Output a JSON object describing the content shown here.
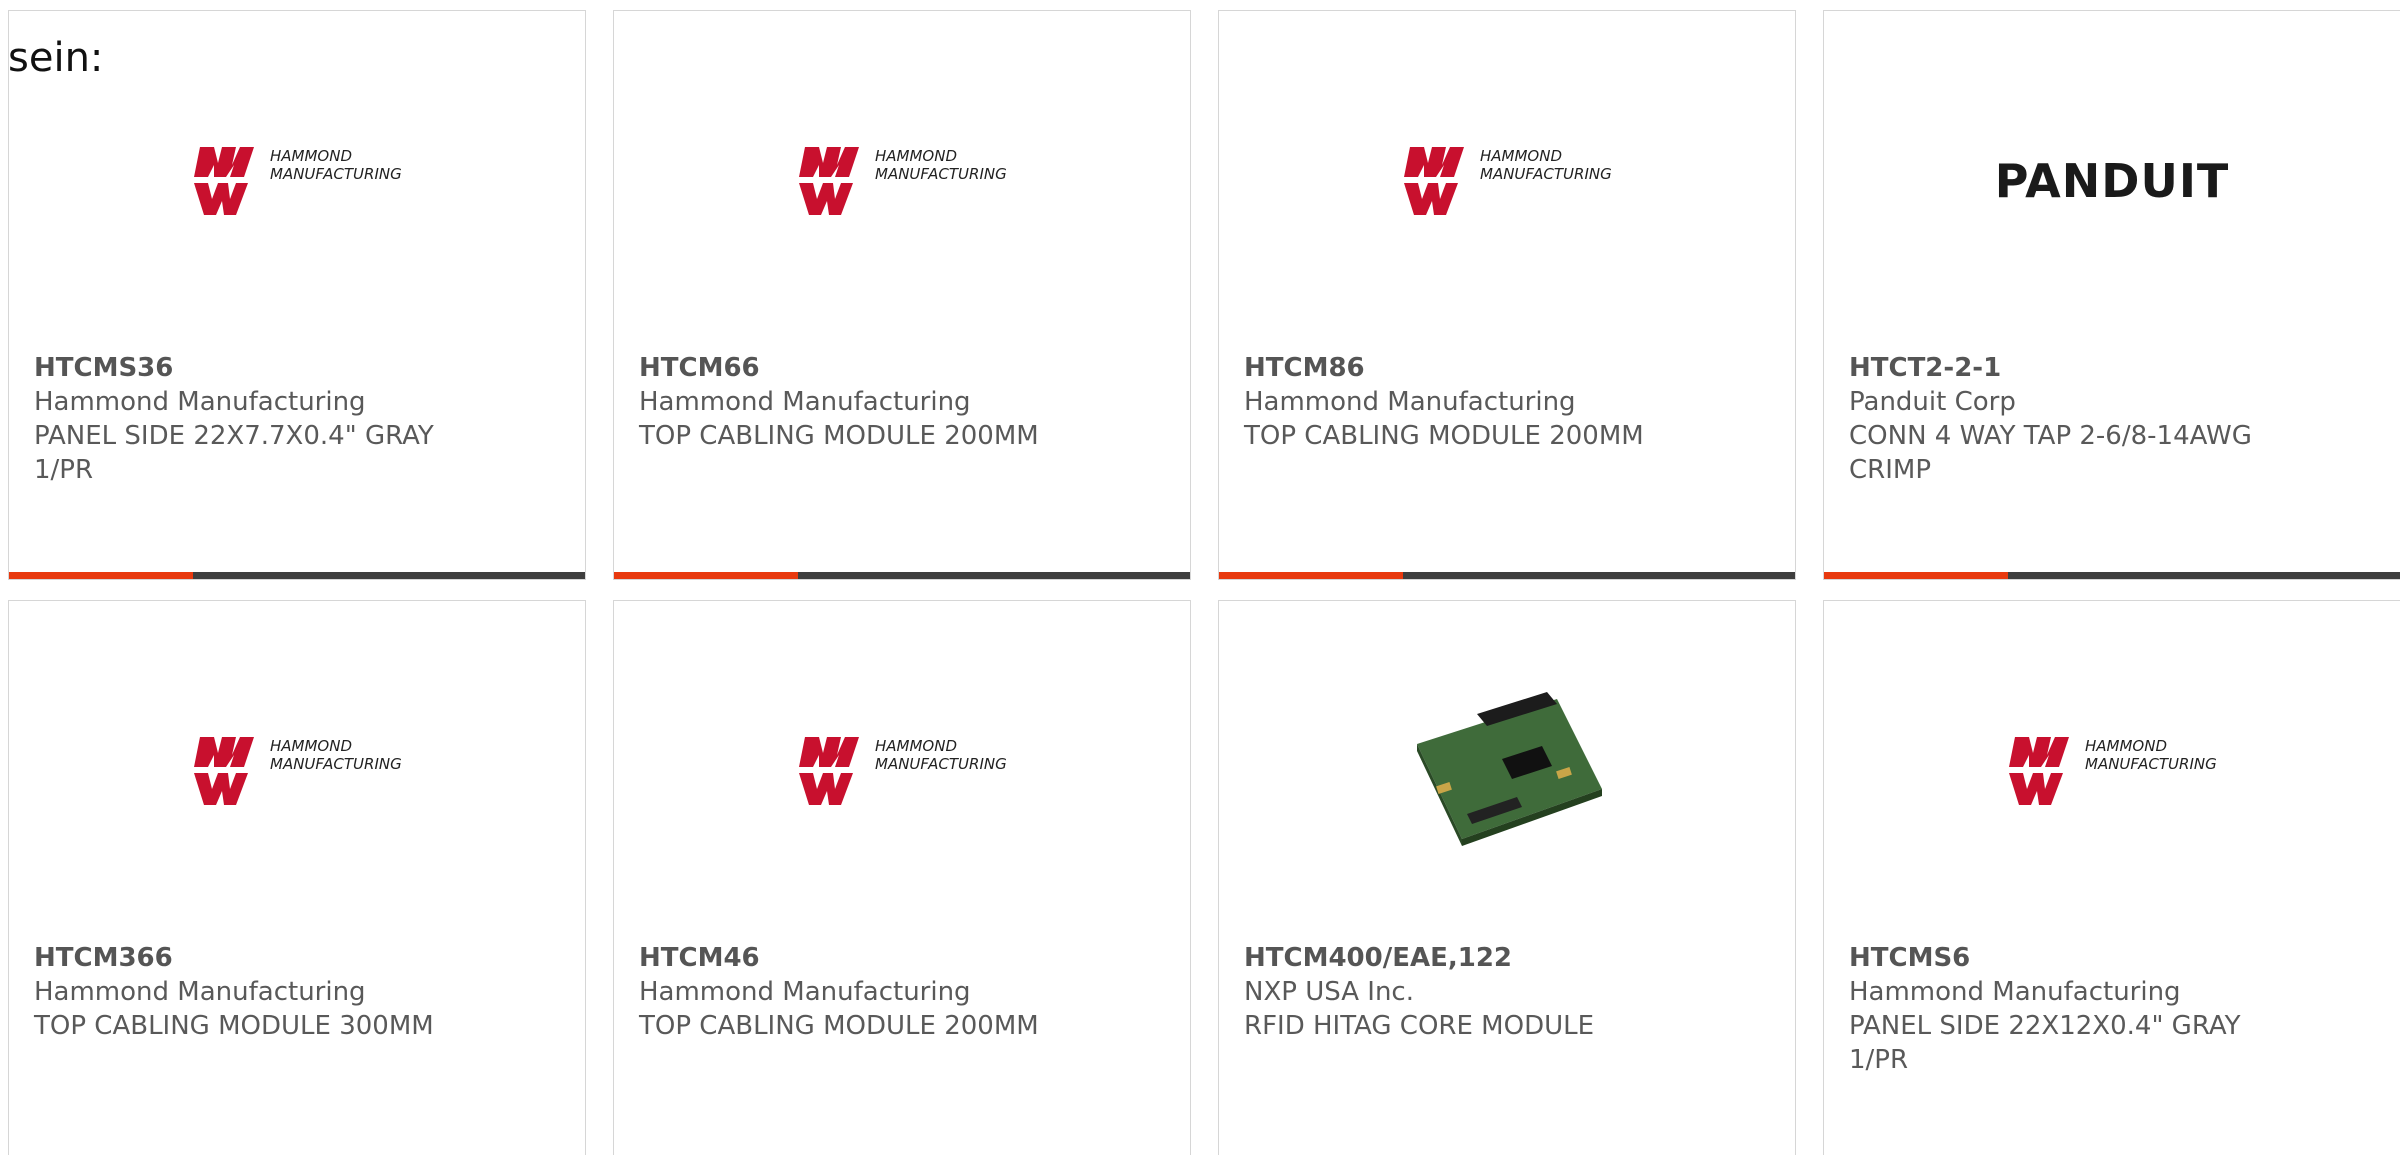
{
  "intro_text": "sein:",
  "products": [
    {
      "part": "HTCMS36",
      "manufacturer": "Hammond Manufacturing",
      "description": "PANEL SIDE 22X7.7X0.4\" GRAY 1/PR",
      "logo": "hammond",
      "hammond_line1": "HAMMOND",
      "hammond_line2": "MANUFACTURING"
    },
    {
      "part": "HTCM66",
      "manufacturer": "Hammond Manufacturing",
      "description": "TOP CABLING MODULE 200MM",
      "logo": "hammond",
      "hammond_line1": "HAMMOND",
      "hammond_line2": "MANUFACTURING"
    },
    {
      "part": "HTCM86",
      "manufacturer": "Hammond Manufacturing",
      "description": "TOP CABLING MODULE 200MM",
      "logo": "hammond",
      "hammond_line1": "HAMMOND",
      "hammond_line2": "MANUFACTURING"
    },
    {
      "part": "HTCT2-2-1",
      "manufacturer": "Panduit Corp",
      "description": "CONN 4 WAY TAP 2-6/8-14AWG CRIMP",
      "logo": "panduit",
      "panduit_text": "PANDUIT"
    },
    {
      "part": "HTCM366",
      "manufacturer": "Hammond Manufacturing",
      "description": "TOP CABLING MODULE 300MM",
      "logo": "hammond",
      "hammond_line1": "HAMMOND",
      "hammond_line2": "MANUFACTURING"
    },
    {
      "part": "HTCM46",
      "manufacturer": "Hammond Manufacturing",
      "description": "TOP CABLING MODULE 200MM",
      "logo": "hammond",
      "hammond_line1": "HAMMOND",
      "hammond_line2": "MANUFACTURING"
    },
    {
      "part": "HTCM400/EAE,122",
      "manufacturer": "NXP USA Inc.",
      "description": "RFID HITAG CORE MODULE",
      "logo": "pcb-photo"
    },
    {
      "part": "HTCMS6",
      "manufacturer": "Hammond Manufacturing",
      "description": "PANEL SIDE 22X12X0.4\" GRAY 1/PR",
      "logo": "hammond",
      "hammond_line1": "HAMMOND",
      "hammond_line2": "MANUFACTURING"
    }
  ],
  "colors": {
    "accent": "#e8390e",
    "bar": "#3e3e3e",
    "hammond_red": "#c8102e",
    "text": "#595959"
  }
}
